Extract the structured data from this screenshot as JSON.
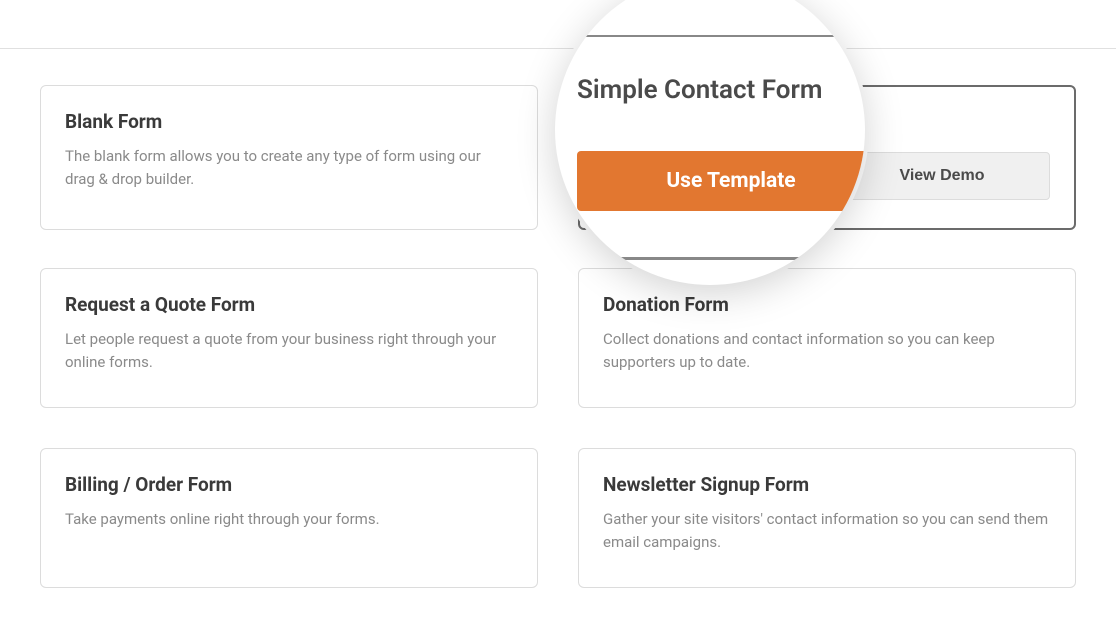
{
  "templates": [
    {
      "title": "Blank Form",
      "description": "The blank form allows you to create any type of form using our drag & drop builder."
    },
    {
      "title": "Simple Contact Form",
      "description": "",
      "use_template_label": "Use Template",
      "view_demo_label": "View Demo"
    },
    {
      "title": "Request a Quote Form",
      "description": "Let people request a quote from your business right through your online forms."
    },
    {
      "title": "Donation Form",
      "description": "Collect donations and contact information so you can keep supporters up to date."
    },
    {
      "title": "Billing / Order Form",
      "description": "Take payments online right through your forms."
    },
    {
      "title": "Newsletter Signup Form",
      "description": "Gather your site visitors' contact information so you can send them email campaigns."
    }
  ],
  "zoom": {
    "title": "Simple Contact Form",
    "use_template_label": "Use Template"
  }
}
